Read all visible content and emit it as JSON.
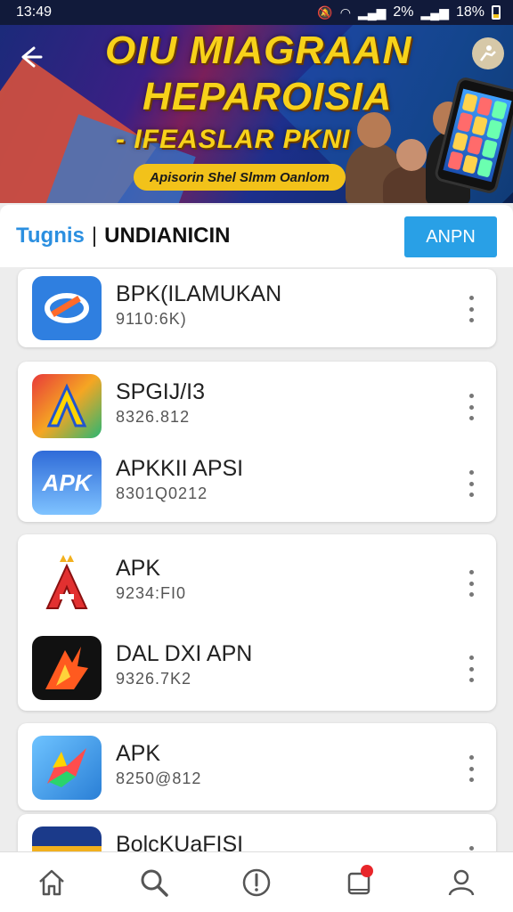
{
  "status_bar": {
    "time": "13:49",
    "battery_a": "2%",
    "battery_b": "18%"
  },
  "banner": {
    "line1": "OIU MIAGRAAN",
    "line2": "HEPAROISIA",
    "line3": "- IFEASLAR PKNI",
    "pill": "Apisorin Shel Slmm Oanlom"
  },
  "header": {
    "brand": "Tugnis",
    "title": "UNDIANICIN",
    "apply_label": "ANPN"
  },
  "apps": [
    {
      "name": "BPK(ILAMUKAN",
      "size": "9110:6K)",
      "icon": "blue-ring-icon"
    },
    {
      "name": "SPGIJ/I3",
      "size": "8326.812",
      "icon": "rainbow-a-icon"
    },
    {
      "name": "APKKII APSI",
      "size": "8301Q0212",
      "icon": "apk-blue-icon"
    },
    {
      "name": "APK",
      "size": "9234​:FI0",
      "icon": "red-a-crown-icon"
    },
    {
      "name": "DAL DXI APN",
      "size": "9326.7K2",
      "icon": "fire-a-icon"
    },
    {
      "name": "APK",
      "size": "8250@812",
      "icon": "colorful-star-icon"
    },
    {
      "name": "BolcKUaFISI",
      "size": "",
      "icon": "navy-banner-icon"
    }
  ],
  "nav": [
    "home-icon",
    "search-icon",
    "alert-icon",
    "notification-icon",
    "profile-icon"
  ],
  "colors": {
    "accent": "#29a0e6",
    "banner_text": "#f7d21a",
    "badge": "#e8262a"
  }
}
